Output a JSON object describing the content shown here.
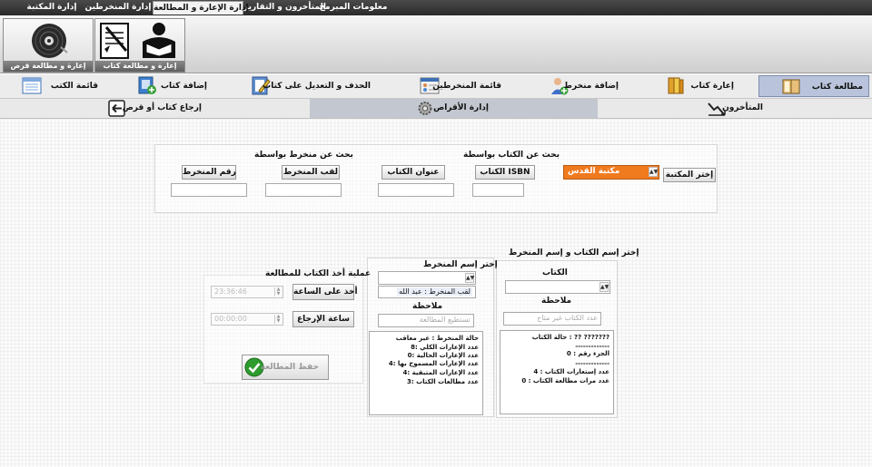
{
  "menu": {
    "items": [
      {
        "label": "معلومات المبرمج"
      },
      {
        "label": "المتأخرون و التقارير"
      },
      {
        "label": "إدارة الإعارة و المطالعة"
      },
      {
        "label": "إدارة المنخرطين"
      },
      {
        "label": "إدارة المكتبة"
      }
    ]
  },
  "ribbon": {
    "book_button": "إعارة و مطالعة كتاب",
    "disc_button": "إعارة و مطالعة قرص"
  },
  "nav": {
    "row1": [
      {
        "label": "مطالعة كتاب"
      },
      {
        "label": "إعارة كتاب"
      },
      {
        "label": "إضافة منخرط"
      },
      {
        "label": "قائمة المنخرطين"
      },
      {
        "label": "الحذف و التعديل على كتاب"
      },
      {
        "label": "إضافة كتاب"
      },
      {
        "label": "قائمة الكتب"
      }
    ],
    "row2": [
      {
        "label": "المتأخرون"
      },
      {
        "label": "إدارة الأقراص"
      },
      {
        "label": "إرجاع كتاب أو قرص"
      }
    ]
  },
  "search": {
    "book_title": "بحث عن الكتاب بواسطة",
    "member_title": "بحث عن منخرط بواسطة",
    "choose_library": "إختر المكتبة",
    "library_value": "مكتبة القدس",
    "isbn_label": "الكتاب ISBN",
    "book_title_label": "عنوان الكتاب",
    "member_lastname_label": "لقب المنخرط",
    "member_number_label": "رقم المنخرط"
  },
  "book_panel": {
    "heading": "إختر إسم الكتاب و إسم المنخرط",
    "book_label": "الكتاب",
    "note_label": "ملاحظة",
    "note_value": "عدد الكتاب غير متاح",
    "info": [
      "حالة الكتاب : ?? ???????",
      "-------------",
      "الجزء رقم : 0",
      "-------------",
      "عدد إستعارات الكتاب : 4",
      "عدد مرات مطالعة الكتاب : 0"
    ]
  },
  "member_panel": {
    "heading": "إختر إسم المنخرط",
    "list_item": "لقب المنخرط : عبد الله",
    "note_label": "ملاحظة",
    "note_value": "تستطيع المطالعة",
    "info": [
      "حالة المنخرط : غير معاقب",
      "عدد الإعارات الكلي :8",
      "عدد الإعارات الحالية :0",
      "عدد الإعارات المسموح بها :4",
      "عدد الإعارات المتبقية :4",
      "عدد مطالعات الكتاب :3"
    ]
  },
  "reading_panel": {
    "title": "عملية أخذ الكتاب للمطالعة",
    "take_time_button": "أخذ على الساعة",
    "take_time_value": "23:36:46",
    "return_time_button": "ساعة الإرجاع",
    "return_time_value": "00:00:00",
    "save_button": "حفظ المطالعة"
  },
  "colors": {
    "accent_orange": "#f07a1e",
    "active_nav": "#b9c4dc",
    "check_green": "#2e9b2e"
  }
}
